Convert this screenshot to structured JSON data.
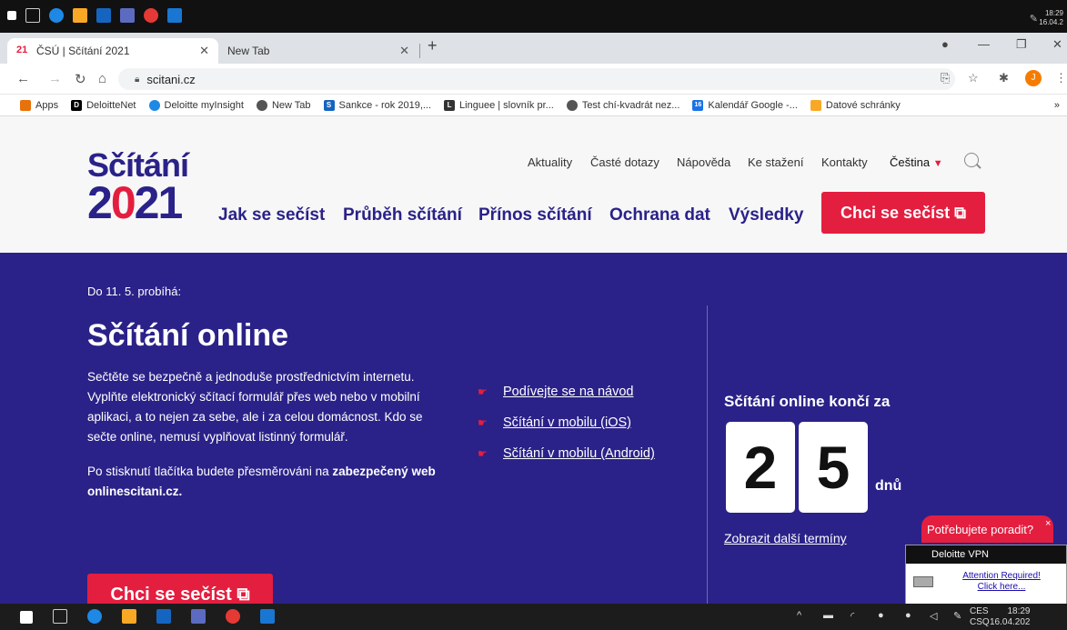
{
  "os_top": {
    "clock_time": "18:29",
    "clock_date": "16.04.2"
  },
  "browser": {
    "tabs": [
      {
        "label": "ČSÚ | Sčítání 2021",
        "favicon": "21"
      },
      {
        "label": "New Tab"
      }
    ],
    "url": "scitani.cz",
    "profile_initial": "J",
    "bookmarks": [
      {
        "label": "Apps",
        "icon": "apps-grid-icon",
        "color": "#e8710a"
      },
      {
        "label": "DeloitteNet",
        "icon": "D",
        "color": "#000000"
      },
      {
        "label": "Deloitte myInsight",
        "icon": "insight-icon",
        "color": "#1e88e5"
      },
      {
        "label": "New Tab",
        "icon": "globe-icon",
        "color": "#555555"
      },
      {
        "label": "Sankce - rok 2019,...",
        "icon": "S",
        "color": "#1565c0"
      },
      {
        "label": "Linguee | slovník pr...",
        "icon": "L",
        "color": "#333333"
      },
      {
        "label": "Test chí-kvadrát nez...",
        "icon": "globe-icon",
        "color": "#555555"
      },
      {
        "label": "Kalendář Google -...",
        "icon": "16",
        "color": "#1a73e8"
      },
      {
        "label": "Datové schránky",
        "icon": "DS",
        "color": "#f9a825"
      }
    ],
    "more_bookmarks": "»"
  },
  "site": {
    "logo_word": "Sčítání",
    "logo_year_a": "2",
    "logo_year_b": "0",
    "logo_year_c": "2",
    "logo_year_d": "1",
    "top_links": [
      "Aktuality",
      "Časté dotazy",
      "Nápověda",
      "Ke stažení",
      "Kontakty"
    ],
    "language": "Čeština",
    "main_nav": [
      "Jak se sečíst",
      "Průběh sčítání",
      "Přínos sčítání",
      "Ochrana dat",
      "Výsledky"
    ],
    "cta_top": "Chci se sečíst ⧉"
  },
  "hero": {
    "pre": "Do 11. 5. probíhá:",
    "title": "Sčítání online",
    "description": "Sečtěte se bezpečně a jednoduše prostřednictvím internetu. Vyplňte elektronický sčítací formulář přes web nebo v mobilní aplikaci, a to nejen za sebe, ale i za celou domácnost. Kdo se sečte online, nemusí vyplňovat listinný formulář.",
    "redirect_text": "Po stisknutí tlačítka budete přesměrováni na ",
    "redirect_bold": "zabezpečený web onlinescitani.cz.",
    "links": [
      "Podívejte se na návod",
      "Sčítání v mobilu (iOS)",
      "Sčítání v mobilu (Android)"
    ],
    "countdown_title": "Sčítání online končí za",
    "digit_1": "2",
    "digit_2": "5",
    "unit": "dnů",
    "more_dates": "Zobrazit další termíny",
    "cta_bottom": "Chci se sečíst ⧉"
  },
  "help": {
    "label": "Potřebujete poradit?",
    "close": "×"
  },
  "vpn": {
    "title": "Deloitte VPN",
    "link": "Attention Required! Click here..."
  },
  "taskbar": {
    "lang_1": "CES",
    "lang_2": "CSQ",
    "time": "18:29",
    "date": "16.04.202"
  },
  "colors": {
    "brand_blue": "#2a2288",
    "brand_red": "#e41e3f"
  }
}
